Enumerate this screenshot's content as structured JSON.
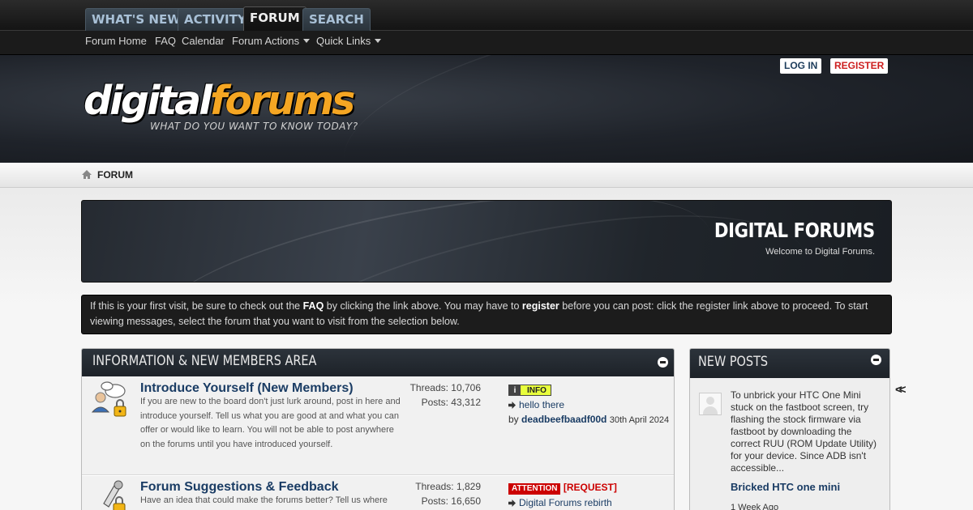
{
  "nav": {
    "tabs": [
      {
        "label": "WHAT'S NEW?"
      },
      {
        "label": "ACTIVITY"
      },
      {
        "label": "FORUM"
      },
      {
        "label": "SEARCH"
      }
    ],
    "sublinks": [
      {
        "label": "Forum Home"
      },
      {
        "label": "FAQ"
      },
      {
        "label": "Calendar"
      },
      {
        "label": "Forum Actions"
      },
      {
        "label": "Quick Links"
      }
    ]
  },
  "header": {
    "logo_part1": "digital",
    "logo_part2": "forums",
    "tagline": "WHAT DO YOU WANT TO KNOW TODAY?",
    "login_label": "LOG IN",
    "register_label": "REGISTER"
  },
  "breadcrumb": {
    "current": "FORUM"
  },
  "banner": {
    "title": "DIGITAL FORUMS",
    "subtitle": "Welcome to Digital Forums."
  },
  "notice": {
    "part1": "If this is your first visit, be sure to check out the ",
    "faq": "FAQ",
    "part2": " by clicking the link above. You may have to ",
    "register": "register",
    "part3": " before you can post: click the register link above to proceed. To start viewing messages, select the forum that you want to visit from the selection below."
  },
  "forum_block": {
    "title": "INFORMATION & NEW MEMBERS AREA",
    "forums": [
      {
        "title": "Introduce Yourself (New Members)",
        "description": "If you are new to the board don't just lurk around, post in here and introduce yourself. Tell us what you are good at and what you can offer or would like to learn. You will not be able to post anywhere on the forums until you have introduced yourself.",
        "threads": "Threads: 10,706",
        "posts": "Posts: 43,312",
        "last_tag": "INFO",
        "last_title": "hello there",
        "last_by": "by ",
        "last_user": "deadbeefbaadf00d",
        "last_date": "30th April 2024"
      },
      {
        "title": "Forum Suggestions & Feedback",
        "description": "Have an idea that could make the forums better? Tell us where",
        "threads": "Threads: 1,829",
        "posts": "Posts: 16,650",
        "last_tag": "ATTENTION",
        "last_prefix": "[REQUEST]",
        "last_title": "Digital Forums rebirth"
      }
    ]
  },
  "new_posts": {
    "title": "NEW POSTS",
    "snippet": "To unbrick your HTC One Mini stuck on the fastboot screen, try flashing the stock firmware via fastboot by downloading the correct RUU (ROM Update Utility) for your device. Since ADB isn't accessible...",
    "post_title": "Bricked HTC one mini",
    "post_date": "1 Week Ago"
  },
  "colors": {
    "accent": "#f5a623",
    "link": "#1a3c64",
    "register_red": "#cc1d1d"
  }
}
